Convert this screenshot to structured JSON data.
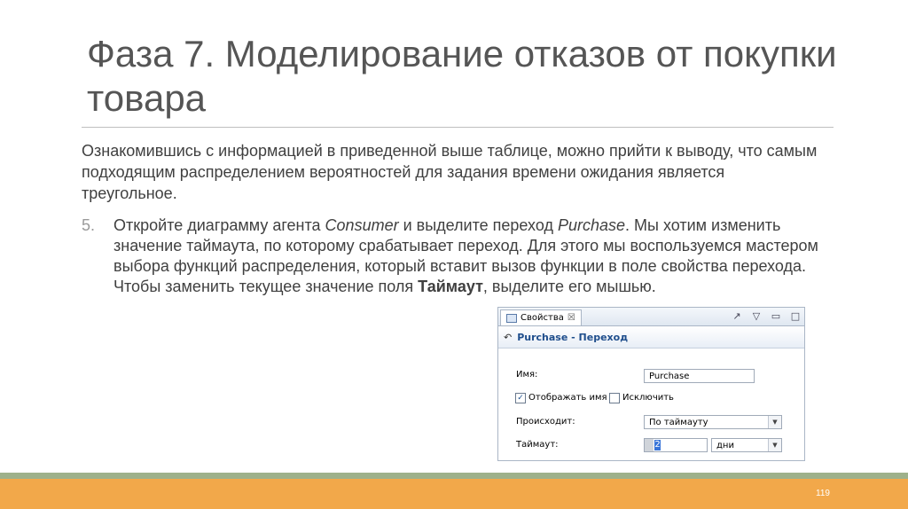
{
  "slide": {
    "title": "Фаза 7. Моделирование отказов от покупки товара",
    "intro": "Ознакомившись с информацией в приведенной выше таблице, можно прийти к выводу, что самым подходящим распределением вероятностей для задания времени ожидания является треугольное.",
    "step": {
      "number": "5.",
      "text_1": "Откройте диаграмму агента ",
      "agent": "Consumer",
      "text_2": " и выделите переход ",
      "transition": "Purchase",
      "text_3": ". Мы хотим изменить значение таймаута, по которому срабатывает переход. Для этого мы воспользуемся мастером выбора функций распределения, который вставит вызов функции в поле свойства перехода. Чтобы заменить текущее значение поля ",
      "field": "Таймаут",
      "text_4": ", выделите его мышью."
    },
    "page_number": "119"
  },
  "properties_panel": {
    "tab_label": "Свойства",
    "tab_close": "☒",
    "header_title": "Purchase - Переход",
    "name_label": "Имя:",
    "name_value": "Purchase",
    "show_name_label": "Отображать имя",
    "show_name_checked": true,
    "exclude_label": "Исключить",
    "exclude_checked": false,
    "trigger_label": "Происходит:",
    "trigger_value": "По таймауту",
    "timeout_label": "Таймаут:",
    "timeout_value": "2",
    "timeout_unit": "дни"
  },
  "colors": {
    "footer_green": "#9eb18b",
    "footer_orange": "#f2a84a",
    "panel_header_text": "#1f4e8c"
  }
}
